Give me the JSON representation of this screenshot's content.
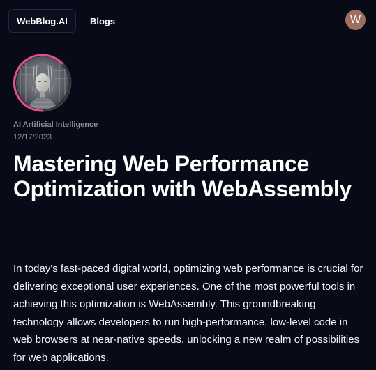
{
  "header": {
    "brand_label": "WebBlog.AI",
    "nav_blogs_label": "Blogs",
    "user_initial": "W"
  },
  "post": {
    "category": "AI Artificial Intelligence",
    "date": "12/17/2023",
    "title": "Mastering Web Performance Optimization with WebAssembly",
    "intro": "In today's fast-paced digital world, optimizing web performance is crucial for delivering exceptional user experiences. One of the most powerful tools in achieving this optimization is WebAssembly. This groundbreaking technology allows developers to run high-performance, low-level code in web browsers at near-native speeds, unlocking a new realm of possibilities for web applications."
  },
  "colors": {
    "background": "#080a18",
    "avatar_ring": "#e5508c",
    "user_avatar": "#9f6f5e",
    "muted_text": "#8b8f9e"
  }
}
